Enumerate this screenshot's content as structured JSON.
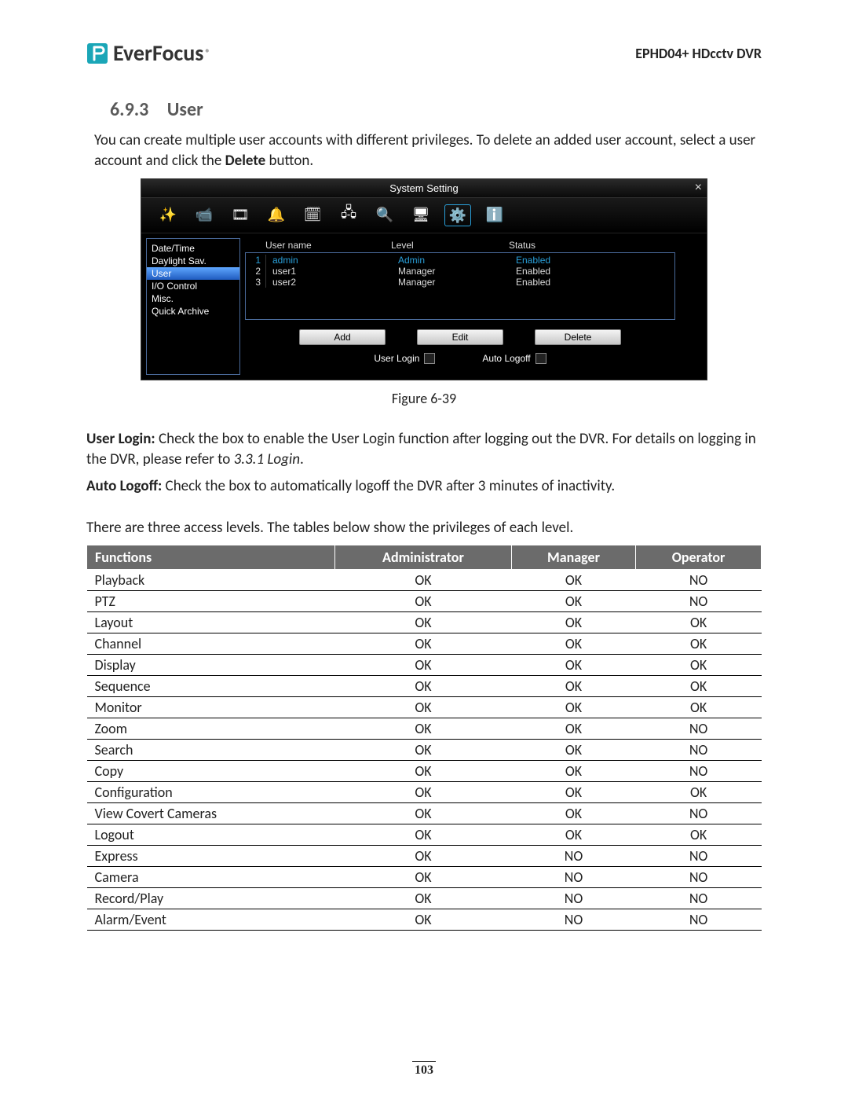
{
  "header": {
    "brand": "EverFocus",
    "product": "EPHD04+  HDcctv DVR"
  },
  "section": {
    "number": "6.9.3",
    "title": "User"
  },
  "intro_text_1": "You can create multiple user accounts with different privileges. To delete an added user account, select a user account and click the ",
  "intro_bold": "Delete",
  "intro_text_2": " button.",
  "dvr": {
    "window_title": "System Setting",
    "sidebar": [
      {
        "label": "Date/Time",
        "selected": false
      },
      {
        "label": "Daylight Sav.",
        "selected": false
      },
      {
        "label": "User",
        "selected": true
      },
      {
        "label": "I/O Control",
        "selected": false
      },
      {
        "label": "Misc.",
        "selected": false
      },
      {
        "label": "Quick Archive",
        "selected": false
      }
    ],
    "columns": {
      "c0": "",
      "c1": "User name",
      "c2": "Level",
      "c3": "Status"
    },
    "rows": [
      {
        "idx": "1",
        "user": "admin",
        "level": "Admin",
        "status": "Enabled",
        "selected": true
      },
      {
        "idx": "2",
        "user": "user1",
        "level": "Manager",
        "status": "Enabled",
        "selected": false
      },
      {
        "idx": "3",
        "user": "user2",
        "level": "Manager",
        "status": "Enabled",
        "selected": false
      }
    ],
    "buttons": {
      "add": "Add",
      "edit": "Edit",
      "delete": "Delete"
    },
    "checks": {
      "user_login": "User Login",
      "auto_logoff": "Auto Logoff"
    }
  },
  "figure_caption": "Figure 6-39",
  "para_userlogin_bold": "User Login:",
  "para_userlogin_text": " Check the box to enable the User Login function after logging out the DVR. For details on logging in the DVR, please refer to ",
  "para_userlogin_italic": "3.3.1 Login",
  "para_userlogin_end": ".",
  "para_autologoff_bold": "Auto Logoff:",
  "para_autologoff_text": " Check the box to automatically logoff the DVR after 3 minutes of inactivity.",
  "para_levels_intro": "There are three access levels. The tables below show the privileges of each level.",
  "priv_table": {
    "headers": [
      "Functions",
      "Administrator",
      "Manager",
      "Operator"
    ],
    "rows": [
      [
        "Playback",
        "OK",
        "OK",
        "NO"
      ],
      [
        "PTZ",
        "OK",
        "OK",
        "NO"
      ],
      [
        "Layout",
        "OK",
        "OK",
        "OK"
      ],
      [
        "Channel",
        "OK",
        "OK",
        "OK"
      ],
      [
        "Display",
        "OK",
        "OK",
        "OK"
      ],
      [
        "Sequence",
        "OK",
        "OK",
        "OK"
      ],
      [
        "Monitor",
        "OK",
        "OK",
        "OK"
      ],
      [
        "Zoom",
        "OK",
        "OK",
        "NO"
      ],
      [
        "Search",
        "OK",
        "OK",
        "NO"
      ],
      [
        "Copy",
        "OK",
        "OK",
        "NO"
      ],
      [
        "Configuration",
        "OK",
        "OK",
        "OK"
      ],
      [
        "View Covert Cameras",
        "OK",
        "OK",
        "NO"
      ],
      [
        "Logout",
        "OK",
        "OK",
        "OK"
      ],
      [
        "Express",
        "OK",
        "NO",
        "NO"
      ],
      [
        "Camera",
        "OK",
        "NO",
        "NO"
      ],
      [
        "Record/Play",
        "OK",
        "NO",
        "NO"
      ],
      [
        "Alarm/Event",
        "OK",
        "NO",
        "NO"
      ]
    ]
  },
  "page_number": "103"
}
